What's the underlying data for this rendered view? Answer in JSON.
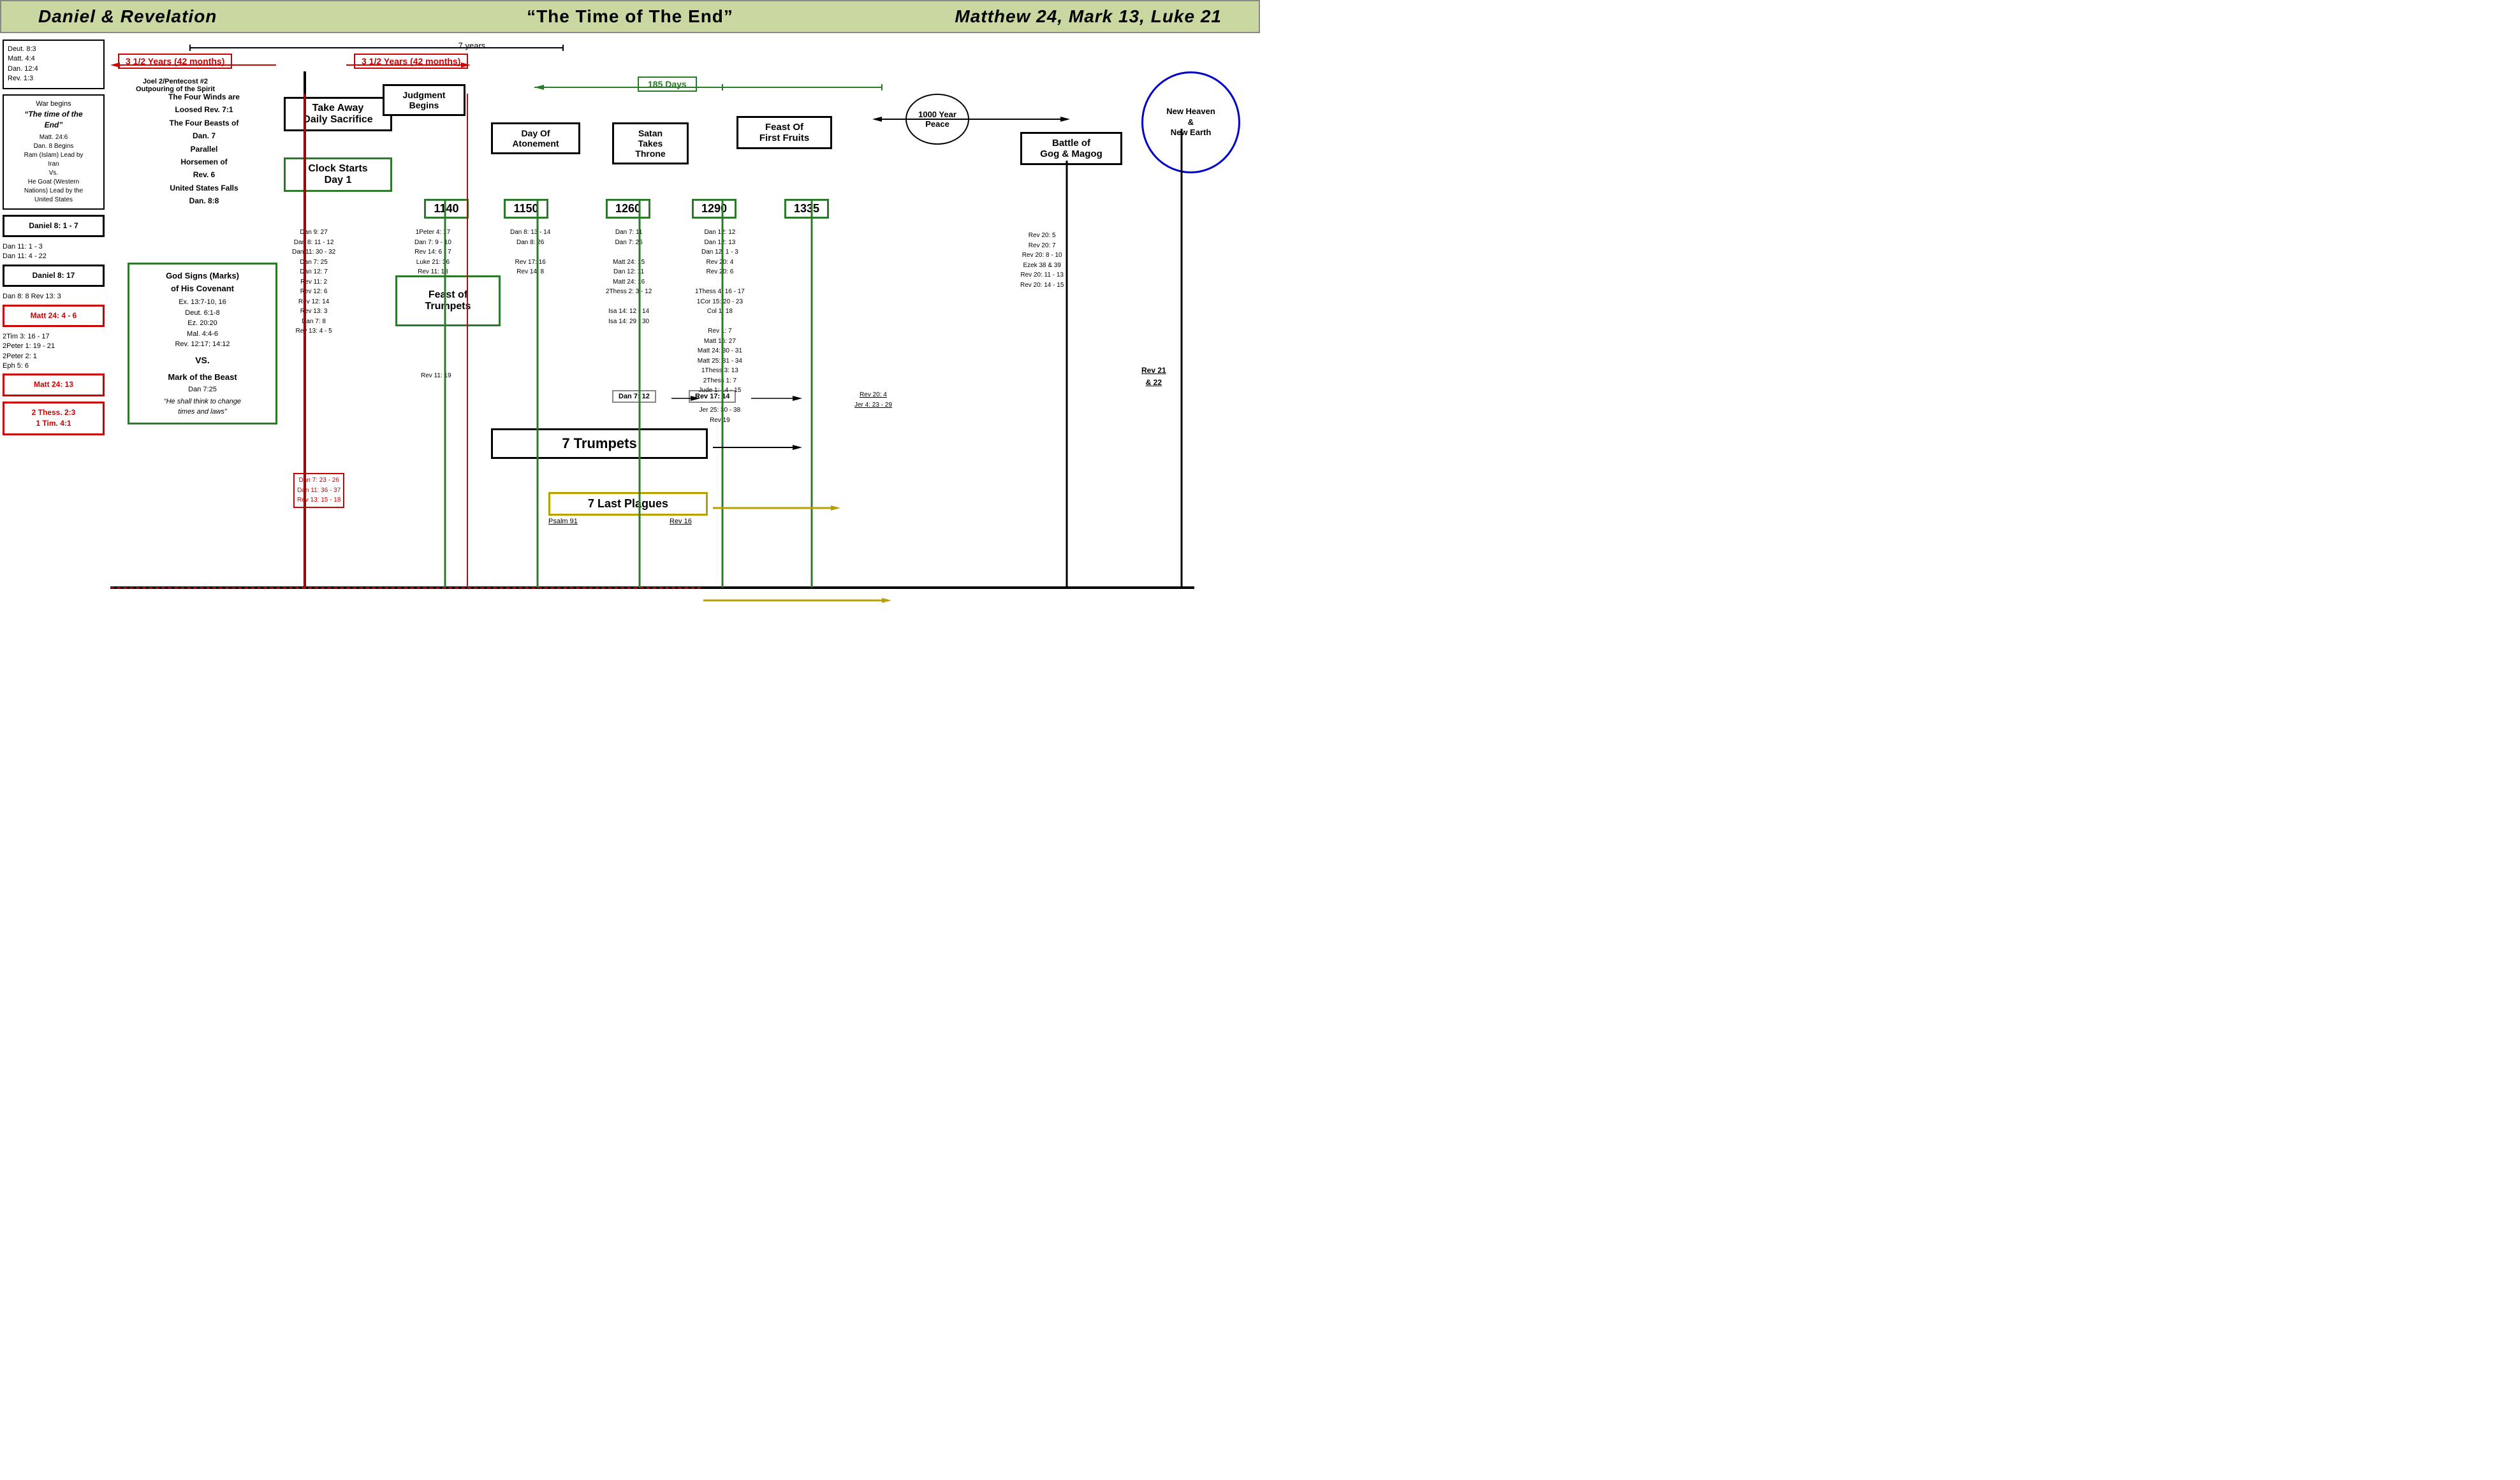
{
  "header": {
    "left": "Daniel & Revelation",
    "center": "“The Time of The End”",
    "right": "Matthew 24, Mark 13, Luke 21"
  },
  "timeline": {
    "seven_years_label": "7 years",
    "first_half_label": "3 1/2 Years  (42 months)",
    "second_half_label": "3 1/2 Years  (42 months)",
    "judgment_begins": "Judgment\nBegins",
    "joel_label": "Joel 2/Pentecost #2\nOutpouring of the Spirit",
    "take_away_daily": "Take Away\nDaily Sacrifice",
    "clock_starts": "Clock Starts\nDay 1",
    "day_of_atonement": "Day Of\nAtonement",
    "satan_takes_throne": "Satan\nTakes\nThrone",
    "feast_first_fruits": "Feast Of\nFirst Fruits",
    "battle_gog_magog": "Battle of\nGog & Magog",
    "new_heaven_earth": "New Heaven\n&\nNew Earth",
    "feast_of_trumpets": "Feast of\nTrumpets",
    "seven_trumpets": "7 Trumpets",
    "seven_last_plagues": "7 Last Plagues",
    "days_185": "185 Days",
    "days_1000": "1000 Year\nPeace",
    "milestones": [
      "1140",
      "1150",
      "1260",
      "1290",
      "1335"
    ],
    "four_winds": "The Four Winds are",
    "loosed": "Loosed Rev. 7:1",
    "four_beasts": "The Four Beasts of",
    "dan7": "Dan. 7",
    "parallel": "Parallel",
    "horsemen": "Horsemen of",
    "rev6": "Rev. 6",
    "us_falls": "United States Falls",
    "dan88": "Dan. 8:8",
    "god_signs_title": "God Signs (Marks)\nof His Covenant",
    "god_signs_refs": "Ex. 13:7-10, 16\nDeut. 6:1-8\nEz. 20:20\nMal. 4:4-6\nRev. 12:17; 14:12",
    "vs": "VS.",
    "mark_beast": "Mark of the Beast",
    "dan725": "Dan 7:25",
    "beast_quote": "“He shall think to change\ntimes and laws”"
  },
  "sidebar": {
    "refs_top": "Deut. 8:3\nMatt. 4:4\nDan. 12:4\nRev. 1:3",
    "war_begins_title": "War begins",
    "time_of_end": "“The time of the\nEnd”",
    "war_refs": "Matt. 24:6\nDan. 8 Begins\nRam (Islam) Lead by\nIran\nVs.\nHe Goat (Western\nNations) Lead by the\nUnited States",
    "daniel_8_1_7": "Daniel 8: 1 - 7",
    "dan11_refs": "Dan 11: 1 - 3\nDan 11: 4 - 22",
    "daniel_8_17": "Daniel 8: 17",
    "dan8_rev": "Dan 8: 8  Rev 13: 3",
    "matt_24_4_6": "Matt 24: 4 - 6",
    "misc_refs": "2Tim  3: 16 - 17\n2Peter  1: 19 - 21\n2Peter  2: 1\nEph  5: 6",
    "matt_24_13": "Matt 24: 13",
    "thess_tim": "2 Thess. 2:3\n1 Tim. 4:1"
  },
  "col_refs": {
    "col1": "Dan 9: 27\nDan  8: 11 - 12\nDan 11: 30 - 32\nDan  7: 25\nDan 12: 7\nRev 11: 2\nRev 12: 6\nRev 12: 14\nRev 13: 3\nDan  7: 8\nRev 13: 4 - 5",
    "col1_red": "Dan  7: 23 - 26\nDan 11: 36 - 37\nRev 13: 15 - 18",
    "col2": "1Peter  4: 17\nDan 7: 9 - 10\nRev 14: 6 - 7\nLuke  21: 36\nRev 11: 18",
    "col2b": "Rev 11: 19",
    "col3": "Dan 8: 13 - 14\nDan 8: 26\n\nRev 17: 16\nRev 14: 8",
    "col4": "Dan 7: 11\nDan 7: 26\n\nMatt 24: 15\nDan 12: 11\nMatt 24: 16\n2Thess 2: 3 - 12\n\nIsa  14: 12 - 14\nIsa  14: 29 - 30",
    "col5": "Dan 12: 12\nDan 12: 13\nDan 12: 1 - 3\nRev 20: 4\nRev 20: 6\n\n1Thess  4: 16 - 17\n1Cor  15: 20 - 23\nCol  1: 18\n\nRev 1: 7\nMatt 16: 27\nMatt 24: 30 - 31\nMatt 25: 31 - 34\n1Thess 3: 13\n2Thess 1: 7\nJude 1: 14 - 15\n\nJer 25: 30 - 38\nRev 19",
    "col6": "Rev 20: 4\nJer 4: 23 - 29",
    "col7": "Rev 20: 5\nRev 20: 7\nRev 20: 8 - 10\nEzek 38 & 39\nRev 20: 11 - 13\nRev 20: 14 - 15",
    "col8": "Rev 21\n& 22",
    "dan712_box": "Dan  7: 12",
    "rev1714_box": "Rev  17: 14",
    "psalm91": "Psalm 91",
    "rev16": "Rev 16"
  }
}
